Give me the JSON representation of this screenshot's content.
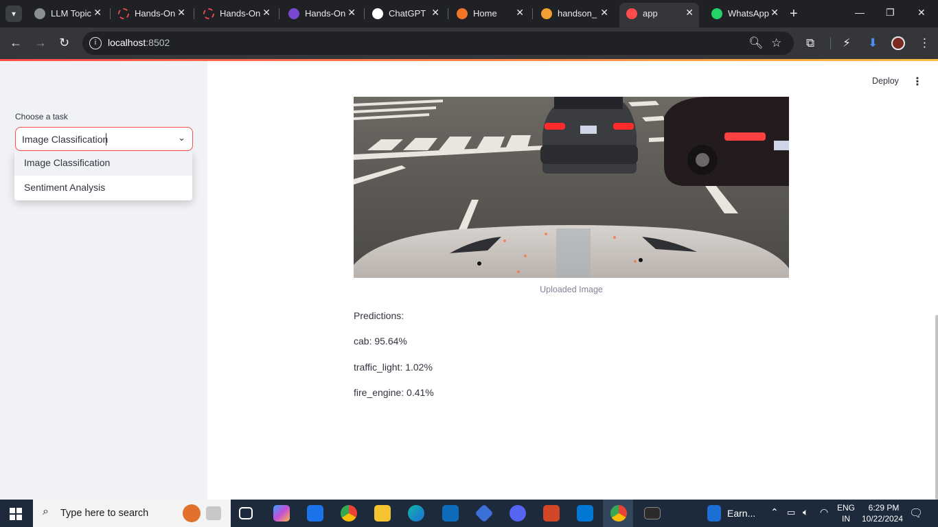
{
  "browser": {
    "tabs": [
      {
        "title": "LLM Topic",
        "icon": "github-icon",
        "color": "#8a8d91"
      },
      {
        "title": "Hands-On",
        "icon": "ring-icon",
        "color": "#e24a43"
      },
      {
        "title": "Hands-On",
        "icon": "ring-icon",
        "color": "#e24a43"
      },
      {
        "title": "Hands-On",
        "icon": "onenote-icon",
        "color": "#7b48d6"
      },
      {
        "title": "ChatGPT",
        "icon": "openai-icon",
        "color": "#ffffff"
      },
      {
        "title": "Home",
        "icon": "jupyter-icon",
        "color": "#f37626"
      },
      {
        "title": "handson_",
        "icon": "hourglass-icon",
        "color": "#f0a030"
      },
      {
        "title": "app",
        "icon": "streamlit-icon",
        "color": "#ff4b4b"
      },
      {
        "title": "WhatsApp",
        "icon": "whatsapp-icon",
        "color": "#25d366"
      }
    ],
    "url_host": "localhost",
    "url_port": ":8502"
  },
  "sidebar": {
    "task_label": "Choose a task",
    "selected": "Image Classification",
    "options": [
      "Image Classification",
      "Sentiment Analysis"
    ]
  },
  "main": {
    "deploy_label": "Deploy",
    "image_caption": "Uploaded Image",
    "predictions_heading": "Predictions:",
    "predictions": [
      "cab: 95.64%",
      "traffic_light: 1.02%",
      "fire_engine: 0.41%"
    ]
  },
  "taskbar": {
    "search_placeholder": "Type here to search",
    "weather": "Earn...",
    "lang_top": "ENG",
    "lang_bottom": "IN",
    "time": "6:29 PM",
    "date": "10/22/2024"
  }
}
